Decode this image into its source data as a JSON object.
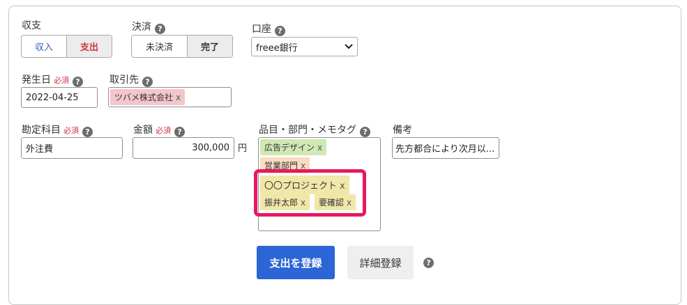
{
  "income_expense": {
    "label": "収支",
    "options": [
      "収入",
      "支出"
    ],
    "selected": "支出"
  },
  "settlement": {
    "label": "決済",
    "options": [
      "未決済",
      "完了"
    ],
    "selected": "完了"
  },
  "account": {
    "label": "口座",
    "value": "freee銀行"
  },
  "issue_date": {
    "label": "発生日",
    "required": "必須",
    "value": "2022-04-25"
  },
  "partner": {
    "label": "取引先",
    "tag": "ツバメ株式会社"
  },
  "account_item": {
    "label": "勘定科目",
    "required": "必須",
    "value": "外注費"
  },
  "amount": {
    "label": "金額",
    "required": "必須",
    "value": "300,000",
    "unit": "円"
  },
  "tags": {
    "label": "品目・部門・メモタグ",
    "items": [
      "広告デザイン",
      "営業部門",
      "〇〇プロジェクト",
      "振井太郎",
      "要確認"
    ],
    "remove": "x"
  },
  "remarks": {
    "label": "備考",
    "value": "先方都合により次月以..."
  },
  "actions": {
    "register_label": "支出を登録",
    "detail_label": "詳細登録"
  },
  "help_glyph": "?",
  "colors": {
    "primary": "#2b65d6",
    "highlight": "#e8185f",
    "required": "#d1363f",
    "income": "#2f62c9",
    "expense": "#d1363f"
  }
}
